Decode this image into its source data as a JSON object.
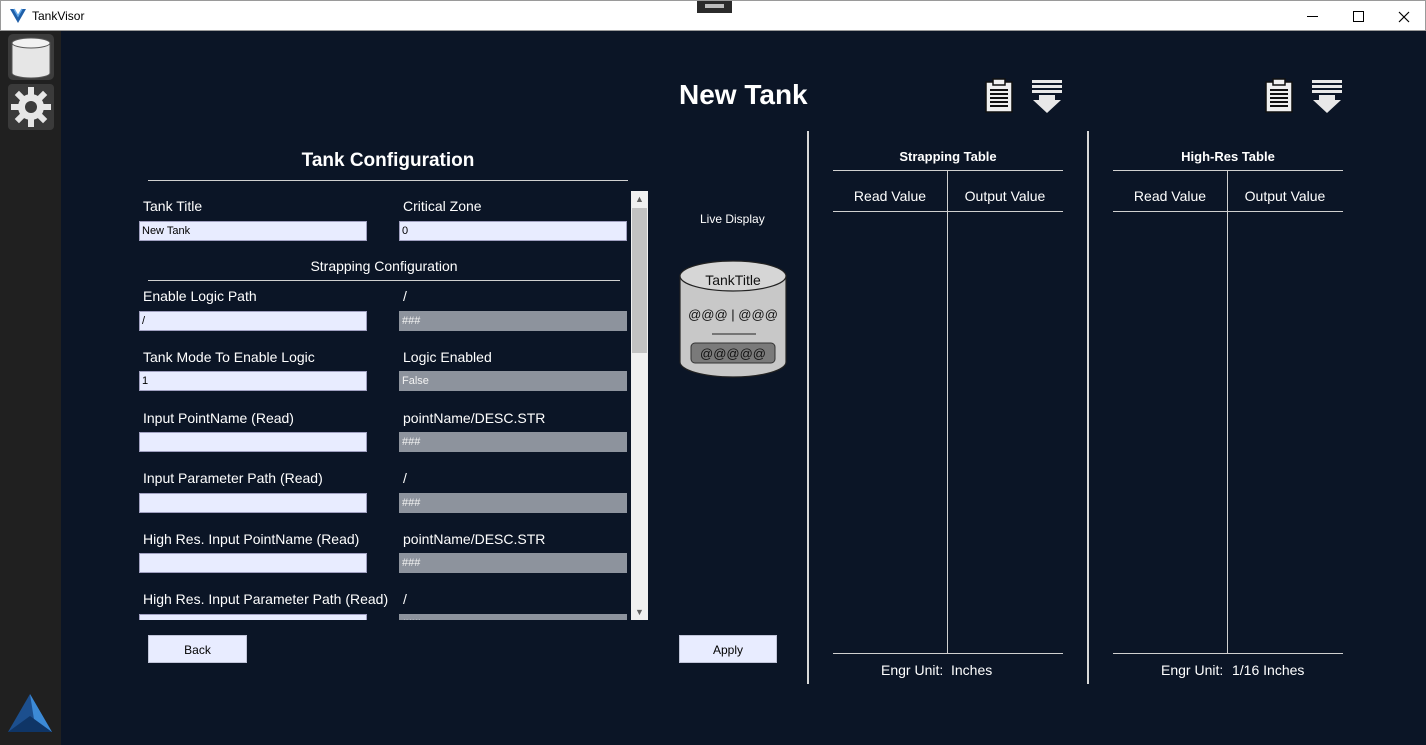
{
  "window": {
    "title": "TankVisor"
  },
  "page": {
    "title": "New Tank"
  },
  "config": {
    "title": "Tank Configuration",
    "strapping_subtitle": "Strapping Configuration",
    "fields": {
      "tank_title": {
        "label": "Tank Title",
        "value": "New Tank"
      },
      "critical_zone": {
        "label": "Critical Zone",
        "value": "0"
      },
      "enable_logic_path": {
        "label": "Enable Logic Path",
        "value": "/"
      },
      "enable_logic_readout": {
        "label": "/",
        "value": "###"
      },
      "tank_mode": {
        "label": "Tank Mode To Enable Logic",
        "value": "1"
      },
      "logic_enabled": {
        "label": "Logic Enabled",
        "value": "False"
      },
      "input_pointname": {
        "label": "Input PointName (Read)",
        "value": ""
      },
      "input_pointname_desc": {
        "label": "pointName/DESC.STR",
        "value": "###"
      },
      "input_param_path": {
        "label": "Input Parameter Path (Read)",
        "value": ""
      },
      "input_param_readout": {
        "label": "/",
        "value": "###"
      },
      "hr_input_pointname": {
        "label": "High Res. Input PointName (Read)",
        "value": ""
      },
      "hr_input_pointname_desc": {
        "label": "pointName/DESC.STR",
        "value": "###"
      },
      "hr_input_param_path": {
        "label": "High Res. Input Parameter Path (Read)",
        "value": ""
      },
      "hr_input_param_readout": {
        "label": "/",
        "value": "###"
      }
    }
  },
  "buttons": {
    "back": "Back",
    "apply": "Apply"
  },
  "live_display": {
    "label": "Live Display",
    "tank_title": "TankTitle",
    "values": "@@@ | @@@",
    "bottom": "@@@@@"
  },
  "strapping_table": {
    "title": "Strapping Table",
    "columns": [
      "Read Value",
      "Output Value"
    ],
    "rows": [],
    "engr_label": "Engr Unit:",
    "engr_value": "Inches"
  },
  "highres_table": {
    "title": "High-Res Table",
    "columns": [
      "Read Value",
      "Output Value"
    ],
    "rows": [],
    "engr_label": "Engr Unit:",
    "engr_value": "1/16 Inches"
  },
  "icons": {
    "sidebar": [
      "database-icon",
      "gear-icon"
    ],
    "table_actions": [
      "clipboard-icon",
      "download-icon"
    ],
    "logo": "triangle-logo-icon"
  },
  "colors": {
    "background": "#0b1526",
    "sidebar": "#202020",
    "input": "#e8ecff",
    "readonly_input": "#8d939d"
  }
}
